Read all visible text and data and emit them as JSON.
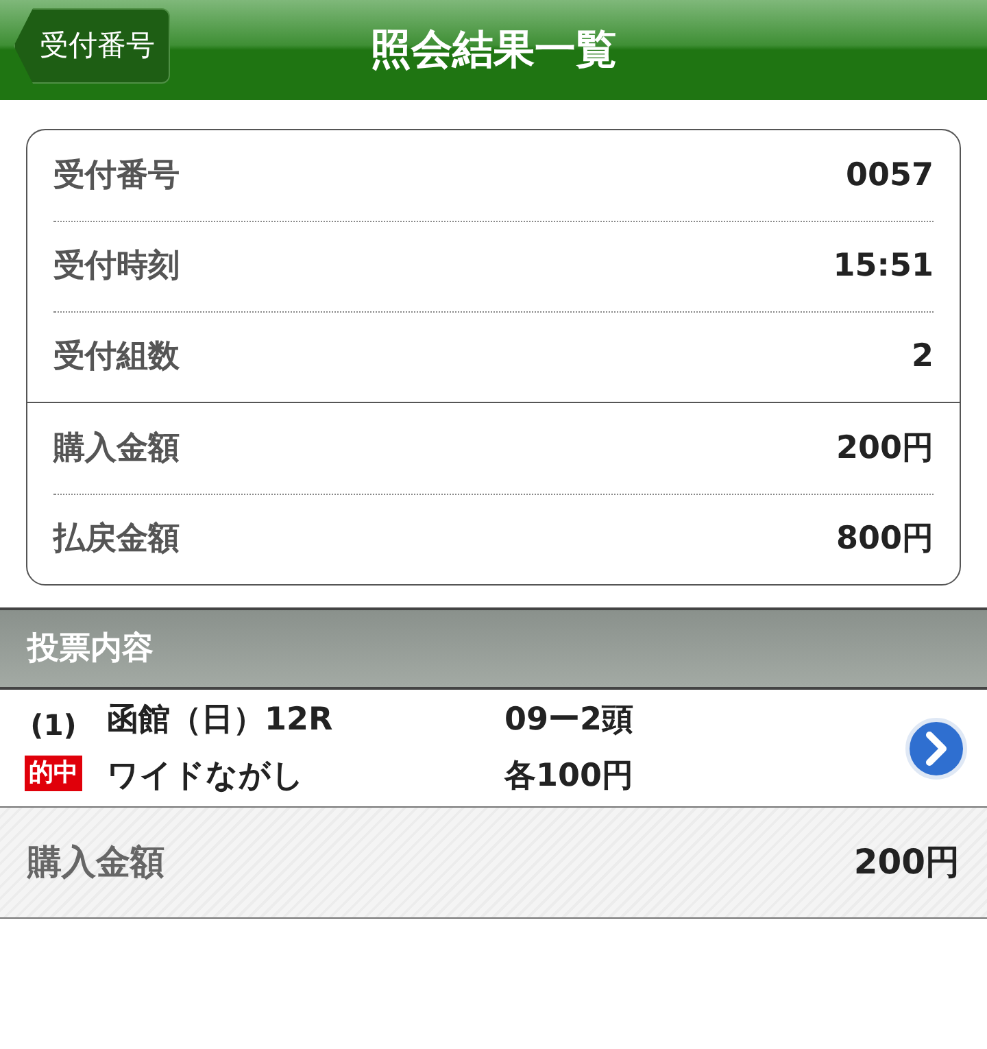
{
  "header": {
    "back_button": "受付番号",
    "title": "照会結果一覧"
  },
  "summary": {
    "groups": [
      [
        {
          "label": "受付番号",
          "value": "0057"
        },
        {
          "label": "受付時刻",
          "value": "15:51"
        },
        {
          "label": "受付組数",
          "value": "2"
        }
      ],
      [
        {
          "label": "購入金額",
          "value": "200円"
        },
        {
          "label": "払戻金額",
          "value": "800円"
        }
      ]
    ]
  },
  "bets_section": {
    "title": "投票内容",
    "bets": [
      {
        "number": "(1)",
        "badge": "的中",
        "race": "函館（日）12R",
        "type": "ワイドながし",
        "combination": "09ー2頭",
        "amount": "各100円"
      }
    ]
  },
  "total": {
    "label": "購入金額",
    "value": "200円"
  }
}
